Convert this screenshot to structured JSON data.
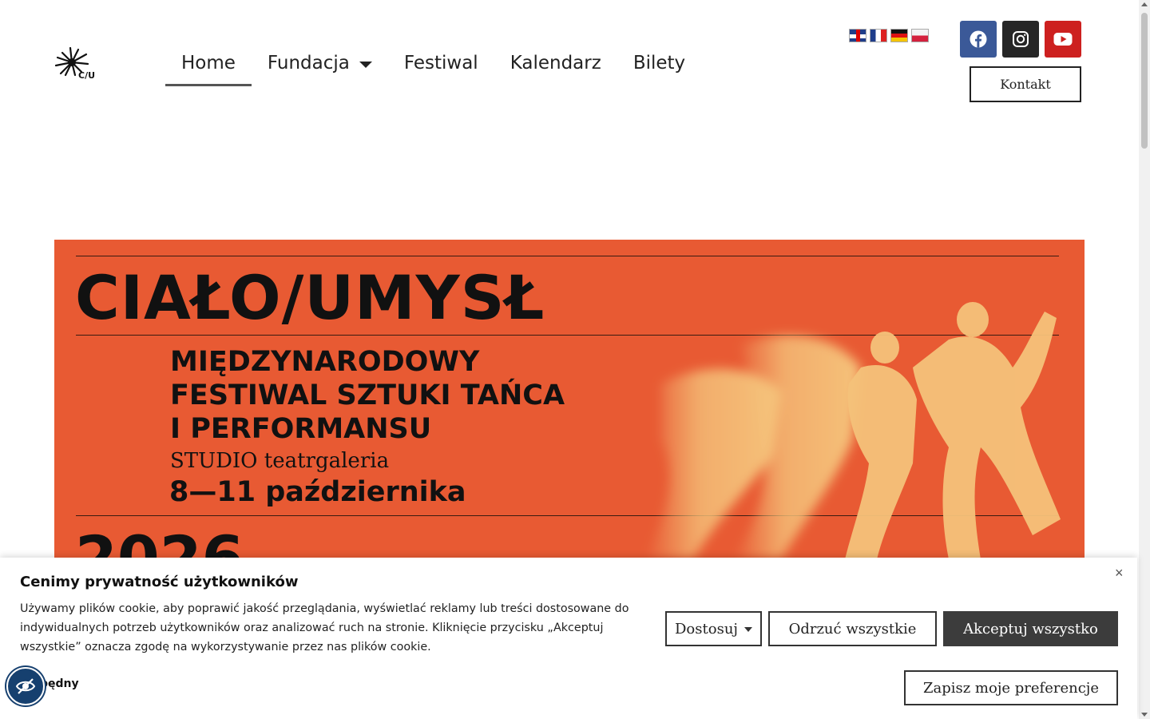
{
  "nav": {
    "items": [
      {
        "label": "Home",
        "active": true
      },
      {
        "label": "Fundacja",
        "has_dropdown": true
      },
      {
        "label": "Festiwal"
      },
      {
        "label": "Kalendarz"
      },
      {
        "label": "Bilety"
      }
    ]
  },
  "logo": {
    "text": "C/U"
  },
  "languages": [
    "en",
    "fr",
    "de",
    "pl"
  ],
  "social": [
    "facebook-icon",
    "instagram-icon",
    "youtube-icon"
  ],
  "header": {
    "contact_label": "Kontakt"
  },
  "banner": {
    "title": "CIAŁO/UMYSŁ",
    "subtitle": "MIĘDZYNARODOWY\nFESTIWAL SZTUKI TAŃCA\nI PERFORMANSU",
    "venue": "STUDIO teatrgaleria",
    "dates": "8—11 października",
    "year": "2026",
    "colors": {
      "background": "#e85a33",
      "figures": "#f5c27a"
    }
  },
  "cookie": {
    "title": "Cenimy prywatność użytkowników",
    "text": "Używamy plików cookie, aby poprawić jakość przeglądania, wyświetlać reklamy lub treści dostosowane do indywidualnych potrzeb użytkowników oraz analizować ruch na stronie. Kliknięcie przycisku „Akceptuj wszystkie” oznacza zgodę na wykorzystywanie przez nas plików cookie.",
    "customize_label": "Dostosuj",
    "reject_label": "Odrzuć wszystkie",
    "accept_label": "Akceptuj wszystko",
    "save_label": "Zapisz moje preferencje",
    "necessary_label": "będny",
    "close_symbol": "×"
  }
}
